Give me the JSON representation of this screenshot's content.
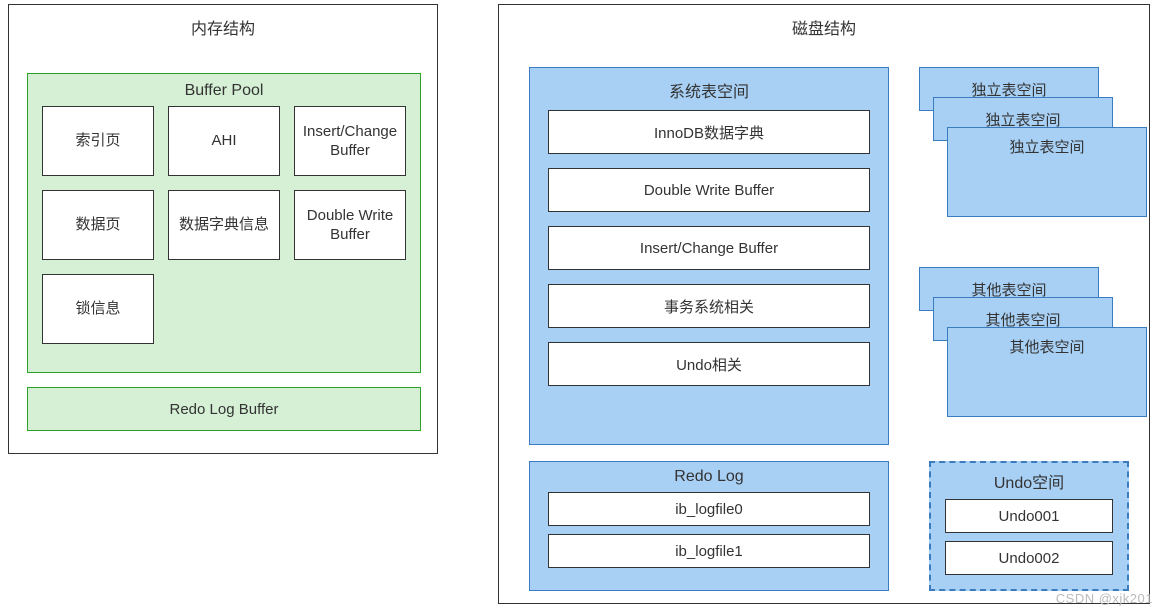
{
  "memory": {
    "title": "内存结构",
    "buffer_pool": {
      "title": "Buffer Pool",
      "cells": [
        "索引页",
        "AHI",
        "Insert/Change Buffer",
        "数据页",
        "数据字典信息",
        "Double Write Buffer",
        "锁信息"
      ]
    },
    "redo_log_buffer": "Redo Log Buffer"
  },
  "disk": {
    "title": "磁盘结构",
    "system_ts": {
      "title": "系统表空间",
      "items": [
        "InnoDB数据字典",
        "Double Write Buffer",
        "Insert/Change Buffer",
        "事务系统相关",
        "Undo相关"
      ]
    },
    "independent_ts": {
      "label": "独立表空间"
    },
    "other_ts": {
      "label": "其他表空间"
    },
    "redo_log": {
      "title": "Redo Log",
      "files": [
        "ib_logfile0",
        "ib_logfile1"
      ]
    },
    "undo": {
      "title": "Undo空间",
      "files": [
        "Undo001",
        "Undo002"
      ]
    }
  },
  "watermark": "CSDN @xjk201"
}
